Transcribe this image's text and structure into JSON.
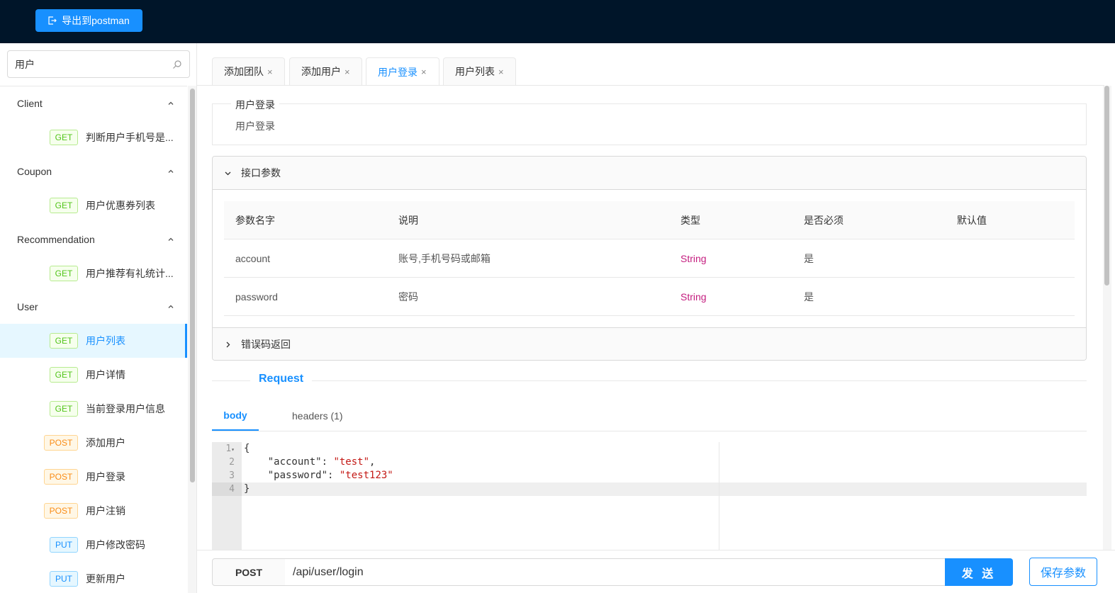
{
  "header": {
    "export_label": "导出到postman"
  },
  "search": {
    "value": "用户"
  },
  "sidebar": {
    "groups": [
      {
        "label": "Client",
        "items": [
          {
            "method": "GET",
            "label": "判断用户手机号是..."
          }
        ]
      },
      {
        "label": "Coupon",
        "items": [
          {
            "method": "GET",
            "label": "用户优惠券列表"
          }
        ]
      },
      {
        "label": "Recommendation",
        "items": [
          {
            "method": "GET",
            "label": "用户推荐有礼统计..."
          }
        ]
      },
      {
        "label": "User",
        "items": [
          {
            "method": "GET",
            "label": "用户列表",
            "active": true
          },
          {
            "method": "GET",
            "label": "用户详情"
          },
          {
            "method": "GET",
            "label": "当前登录用户信息"
          },
          {
            "method": "POST",
            "label": "添加用户"
          },
          {
            "method": "POST",
            "label": "用户登录"
          },
          {
            "method": "POST",
            "label": "用户注销"
          },
          {
            "method": "PUT",
            "label": "用户修改密码"
          },
          {
            "method": "PUT",
            "label": "更新用户"
          }
        ]
      }
    ]
  },
  "tabs": [
    {
      "label": "添加团队"
    },
    {
      "label": "添加用户"
    },
    {
      "label": "用户登录",
      "active": true
    },
    {
      "label": "用户列表"
    }
  ],
  "api": {
    "legend": "用户登录",
    "description": "用户登录"
  },
  "params_panel": {
    "title": "接口参数",
    "columns": [
      "参数名字",
      "说明",
      "类型",
      "是否必须",
      "默认值"
    ],
    "rows": [
      {
        "name": "account",
        "desc": "账号,手机号码或邮箱",
        "type": "String",
        "required": "是",
        "default": ""
      },
      {
        "name": "password",
        "desc": "密码",
        "type": "String",
        "required": "是",
        "default": ""
      }
    ]
  },
  "errors_panel": {
    "title": "错误码返回"
  },
  "request": {
    "title": "Request",
    "tabs": [
      {
        "label": "body",
        "active": true
      },
      {
        "label": "headers (1)"
      }
    ],
    "code": {
      "line_numbers": [
        "1",
        "2",
        "3",
        "4"
      ],
      "open": "{",
      "close": "}",
      "entries": [
        {
          "key": "\"account\"",
          "value": "\"test\"",
          "trail": ","
        },
        {
          "key": "\"password\"",
          "value": "\"test123\"",
          "trail": ""
        }
      ]
    }
  },
  "bottom": {
    "method": "POST",
    "url": "/api/user/login",
    "send_label": "发 送",
    "save_label": "保存参数"
  },
  "colors": {
    "accent": "#1890ff",
    "header_bg": "#001529",
    "get": "#52c41a",
    "post": "#fa8c16",
    "put": "#1890ff",
    "type_string": "#c41d7f"
  }
}
